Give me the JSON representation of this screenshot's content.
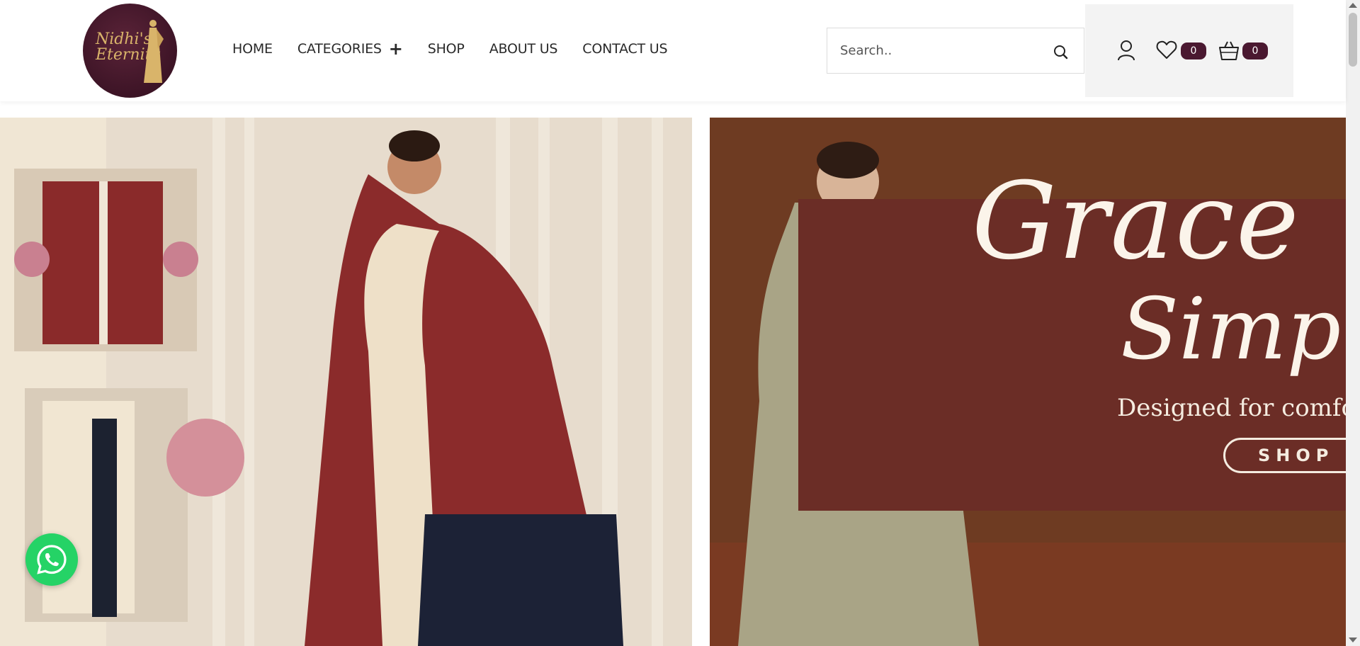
{
  "brand": {
    "logo_text": "Nidhi's Eternity"
  },
  "nav": {
    "items": [
      {
        "label": "HOME"
      },
      {
        "label": "CATEGORIES"
      },
      {
        "label": "SHOP"
      },
      {
        "label": "ABOUT US"
      },
      {
        "label": "CONTACT US"
      }
    ]
  },
  "search": {
    "placeholder": "Search.."
  },
  "header_icons": {
    "wishlist_count": "0",
    "cart_count": "0"
  },
  "hero": {
    "right": {
      "title": "Grace",
      "title2": "Simp",
      "tagline": "Designed for comfort,",
      "button": "SHOP I"
    }
  },
  "colors": {
    "brand": "#4a1830",
    "whatsapp": "#25d366",
    "header_bg": "#ffffff",
    "icon_panel_bg": "#f3f3f3"
  },
  "icons": [
    "search-icon",
    "user-icon",
    "heart-icon",
    "basket-icon",
    "whatsapp-icon",
    "plus-icon"
  ]
}
